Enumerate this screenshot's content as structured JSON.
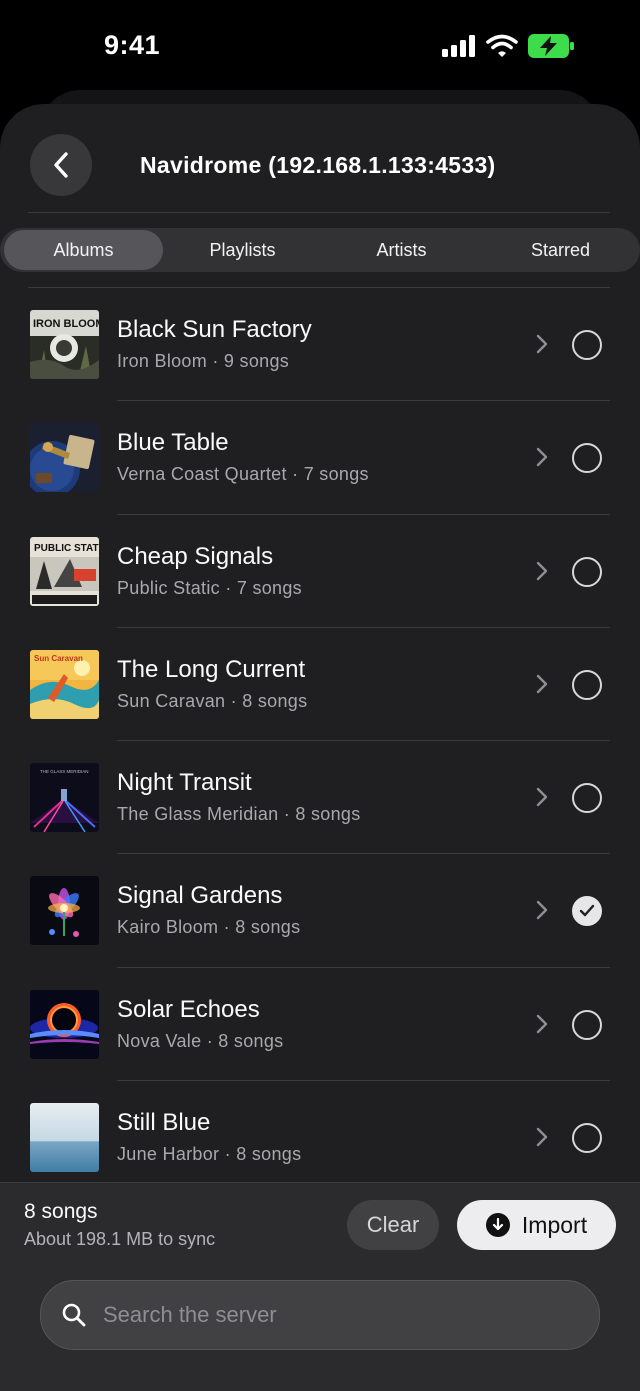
{
  "status_bar": {
    "time": "9:41"
  },
  "header": {
    "title": "Navidrome (192.168.1.133:4533)"
  },
  "tabs": [
    {
      "label": "Albums",
      "active": true
    },
    {
      "label": "Playlists",
      "active": false
    },
    {
      "label": "Artists",
      "active": false
    },
    {
      "label": "Starred",
      "active": false
    }
  ],
  "albums": [
    {
      "title": "Black Sun Factory",
      "meta": "Iron Bloom · 9 songs",
      "selected": false,
      "art_text": "IRON BLOOM"
    },
    {
      "title": "Blue Table",
      "meta": "Verna Coast Quartet · 7 songs",
      "selected": false
    },
    {
      "title": "Cheap Signals",
      "meta": "Public Static · 7 songs",
      "selected": false,
      "art_text": "PUBLIC STATIC"
    },
    {
      "title": "The Long Current",
      "meta": "Sun Caravan · 8 songs",
      "selected": false,
      "art_text": "Sun Caravan"
    },
    {
      "title": "Night Transit",
      "meta": "The Glass Meridian · 8 songs",
      "selected": false,
      "art_text": "THE GLASS MERIDIAN"
    },
    {
      "title": "Signal Gardens",
      "meta": "Kairo Bloom · 8 songs",
      "selected": true
    },
    {
      "title": "Solar Echoes",
      "meta": "Nova Vale · 8 songs",
      "selected": false
    },
    {
      "title": "Still Blue",
      "meta": "June Harbor · 8 songs",
      "selected": false
    }
  ],
  "bottom_bar": {
    "selection_count": "8 songs",
    "selection_size": "About 198.1 MB to sync",
    "clear_label": "Clear",
    "import_label": "Import"
  },
  "search": {
    "placeholder": "Search the server"
  },
  "colors": {
    "background": "#1f1f21",
    "tab_active": "#56565a",
    "import_button": "#ededef",
    "battery": "#3ddc4a"
  }
}
